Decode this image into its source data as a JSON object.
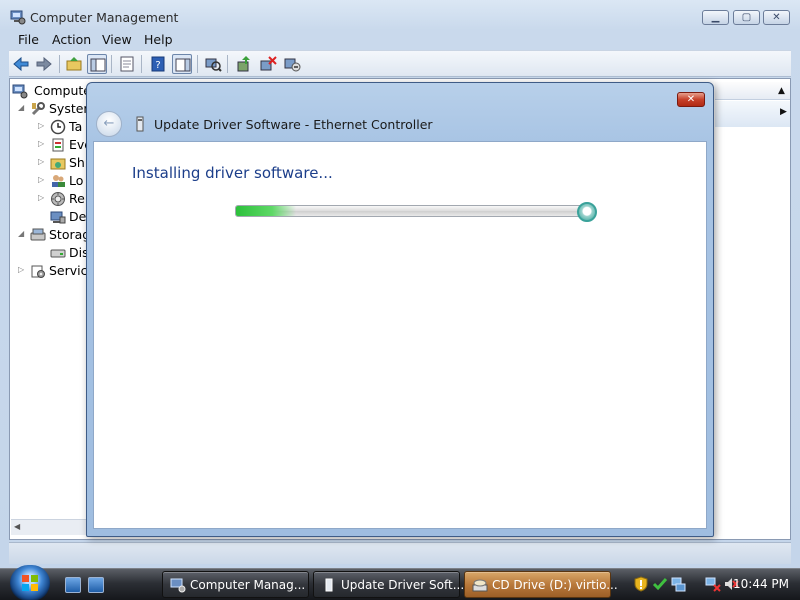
{
  "main_window": {
    "title": "Computer Management",
    "menu": [
      "File",
      "Action",
      "View",
      "Help"
    ],
    "tree": [
      {
        "label": "Computer",
        "indent": 0,
        "icon": "computer-management-icon"
      },
      {
        "label": "System",
        "indent": 1,
        "icon": "tools-icon"
      },
      {
        "label": "Ta",
        "indent": 2,
        "icon": "task-scheduler-icon"
      },
      {
        "label": "Eve",
        "indent": 2,
        "icon": "event-viewer-icon"
      },
      {
        "label": "Sh",
        "indent": 2,
        "icon": "shared-folders-icon"
      },
      {
        "label": "Lo",
        "indent": 2,
        "icon": "local-users-icon"
      },
      {
        "label": "Re",
        "indent": 2,
        "icon": "reliability-icon"
      },
      {
        "label": "De",
        "indent": 2,
        "icon": "device-manager-icon"
      },
      {
        "label": "Storag",
        "indent": 1,
        "icon": "storage-icon"
      },
      {
        "label": "Dis",
        "indent": 2,
        "icon": "disk-management-icon"
      },
      {
        "label": "Service",
        "indent": 1,
        "icon": "services-icon"
      }
    ]
  },
  "dialog": {
    "title": "Update Driver Software - Ethernet Controller",
    "heading": "Installing driver software...",
    "progress_fraction": 0.17
  },
  "taskbar": {
    "tasks": [
      {
        "label": "Computer Manag...",
        "icon": "computer-management-icon"
      },
      {
        "label": "Update Driver Soft...",
        "icon": "device-icon"
      },
      {
        "label": "CD Drive (D:) virtio...",
        "icon": "cd-drive-icon"
      }
    ],
    "clock": "10:44 PM"
  }
}
